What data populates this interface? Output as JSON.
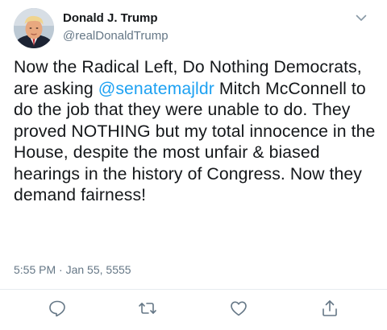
{
  "user": {
    "name": "Donald J. Trump",
    "handle": "@realDonaldTrump"
  },
  "tweet": {
    "text_part1": "Now the Radical Left, Do Nothing Democrats, are asking ",
    "mention": "@senatemajldr",
    "text_part2": " Mitch McConnell to do the job that they were unable to do. They proved NOTHING but my total innocence in the House, despite the most unfair & biased hearings in the history of Congress. Now they demand fairness!",
    "time": "5:55 PM",
    "separator": "·",
    "date": "Jan 55, 5555"
  },
  "icons": {
    "menu": "chevron-down-icon",
    "reply": "reply-icon",
    "retweet": "retweet-icon",
    "like": "heart-icon",
    "share": "share-icon"
  },
  "colors": {
    "link": "#1da1f2",
    "secondary_text": "#657786",
    "primary_text": "#14171a",
    "divider": "#e6ecf0"
  }
}
